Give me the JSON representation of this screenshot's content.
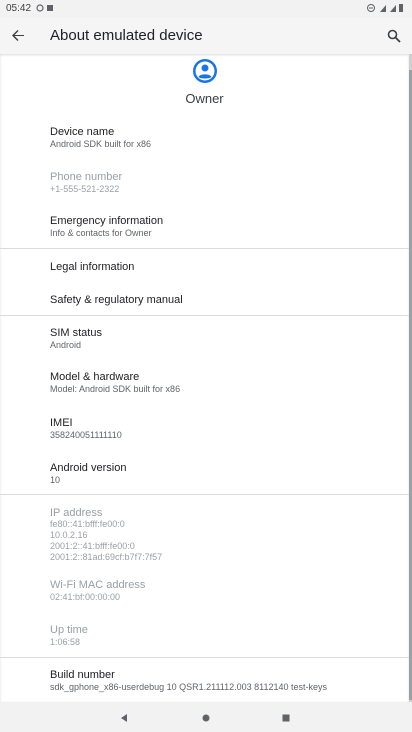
{
  "status_bar": {
    "time": "05:42"
  },
  "app_bar": {
    "title": "About emulated device"
  },
  "header": {
    "owner_label": "Owner"
  },
  "items": [
    {
      "title": "Device name",
      "subtitle": "Android SDK built for x86"
    },
    {
      "title": "Phone number",
      "subtitle": "+1-555-521-2322"
    },
    {
      "title": "Emergency information",
      "subtitle": "Info & contacts for Owner"
    },
    {
      "title": "Legal information",
      "subtitle": ""
    },
    {
      "title": "Safety & regulatory manual",
      "subtitle": ""
    },
    {
      "title": "SIM status",
      "subtitle": "Android"
    },
    {
      "title": "Model & hardware",
      "subtitle": "Model: Android SDK built for x86"
    },
    {
      "title": "IMEI",
      "subtitle": "358240051111110"
    },
    {
      "title": "Android version",
      "subtitle": "10"
    },
    {
      "title": "IP address",
      "subtitle_lines": [
        "fe80::41:bfff:fe00:0",
        "10.0.2.16",
        "2001:2::41:bfff:fe00:0",
        "2001:2::81ad:69cf:b7f7:7f57"
      ]
    },
    {
      "title": "Wi-Fi MAC address",
      "subtitle": "02:41:bf:00:00:00"
    },
    {
      "title": "Up time",
      "subtitle": "1:06:58"
    },
    {
      "title": "Build number",
      "subtitle": "sdk_gphone_x86-userdebug 10 QSR1.211112.003 8112140 test-keys"
    }
  ],
  "colors": {
    "accent": "#1a73e8",
    "background": "#ffffff",
    "disabled_text": "#9aa0a6"
  },
  "icons": {
    "back": "arrow-left",
    "search": "magnifier",
    "owner": "account-circle",
    "nav_back": "triangle-left",
    "nav_home": "circle",
    "nav_recents": "square"
  }
}
